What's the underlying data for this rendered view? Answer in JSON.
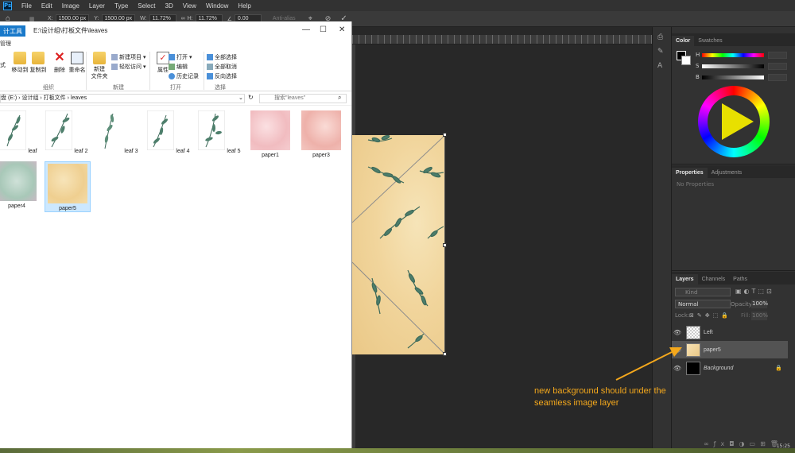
{
  "photoshop": {
    "logo": "Ps",
    "menu": [
      "File",
      "Edit",
      "Image",
      "Layer",
      "Type",
      "Select",
      "3D",
      "View",
      "Window",
      "Help"
    ],
    "options": {
      "x_label": "X:",
      "x_value": "1500.00 px",
      "y_label": "Y:",
      "y_value": "1500.00 px",
      "w_label": "W:",
      "w_value": "11.72%",
      "h_label": "H:",
      "h_value": "11.72%",
      "angle_value": "0.00",
      "anti_alias": "Anti-alias"
    },
    "color_panel": {
      "tabs": [
        "Color",
        "Swatches"
      ],
      "slider_labels": [
        "H",
        "S",
        "B"
      ]
    },
    "properties_panel": {
      "tabs": [
        "Properties",
        "Adjustments"
      ],
      "empty_text": "No Properties"
    },
    "layers_panel": {
      "tabs": [
        "Layers",
        "Channels",
        "Paths"
      ],
      "kind_placeholder": "Kind",
      "blend_mode": "Normal",
      "opacity_label": "Opacity:",
      "opacity_value": "100%",
      "lock_label": "Lock:",
      "fill_label": "Fill:",
      "fill_value": "100%",
      "layers": [
        {
          "name": "Left"
        },
        {
          "name": "paper5"
        },
        {
          "name": "Background"
        }
      ]
    }
  },
  "explorer": {
    "tab_label": "计工具",
    "title_path": "E:\\设计组\\打板文件\\leaves",
    "ribbon_tab": "管理",
    "ribbon": {
      "left_label": "式",
      "move_to": "移动到",
      "copy_to": "复制到",
      "delete": "删除",
      "rename": "重命名",
      "organize": "组织",
      "new_folder": "新建\n文件夹",
      "new_item": "新建项目 ▾",
      "easy_access": "轻松访问 ▾",
      "new_group": "新建",
      "properties": "属性",
      "open": "打开 ▾",
      "edit": "编辑",
      "history": "历史记录",
      "open_group": "打开",
      "select_all": "全部选择",
      "select_none": "全部取消",
      "invert": "反向选择",
      "select_group": "选择"
    },
    "address": "盘 (E:)  ›  设计组  ›  打板文件  ›  leaves",
    "search_placeholder": "搜索\"leaves\"",
    "files": [
      {
        "name": "leaf"
      },
      {
        "name": "leaf 2"
      },
      {
        "name": "leaf 3"
      },
      {
        "name": "leaf 4"
      },
      {
        "name": "leaf 5"
      },
      {
        "name": "paper1"
      },
      {
        "name": "paper3"
      },
      {
        "name": "paper4"
      },
      {
        "name": "paper5"
      }
    ]
  },
  "annotation": {
    "text": "new background should under the seamless image layer",
    "color": "#f4a81c"
  },
  "time": "15:25"
}
